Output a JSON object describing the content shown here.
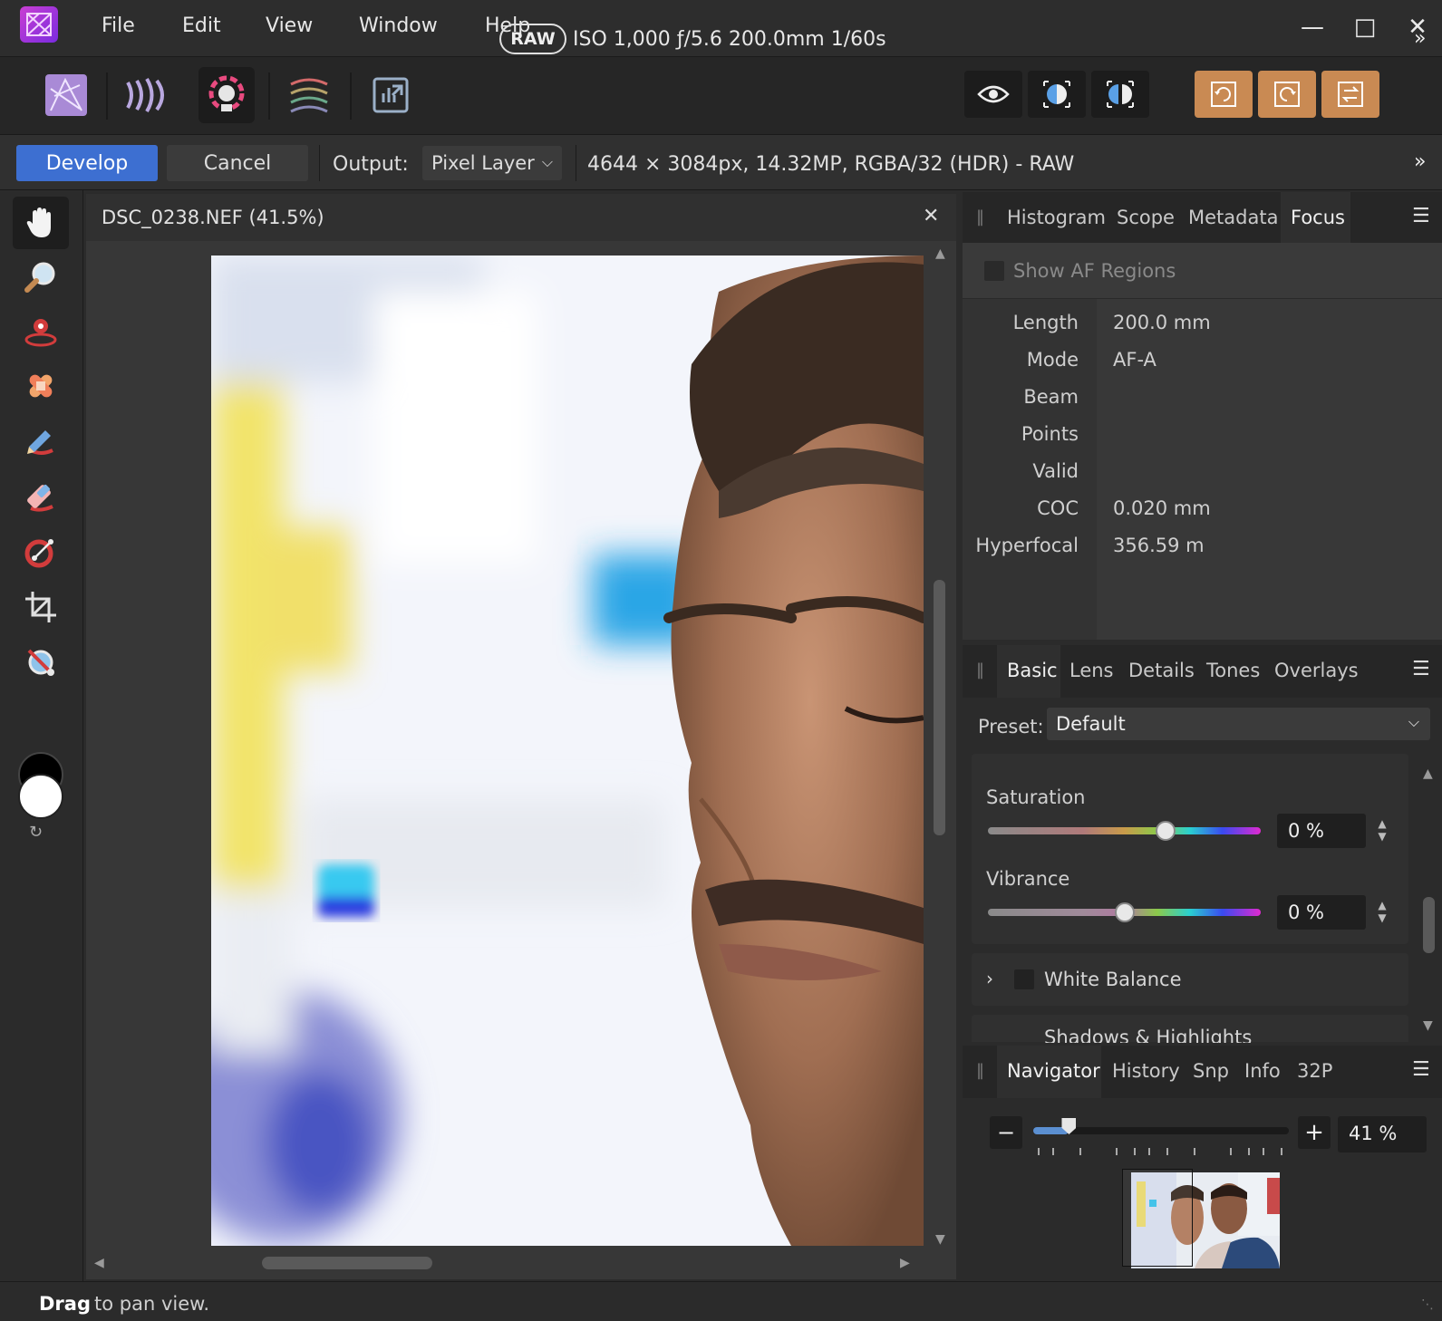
{
  "menubar": {
    "items": [
      "File",
      "Edit",
      "View",
      "Window",
      "Help"
    ],
    "window_controls": {
      "minimize": "—",
      "maximize": "□",
      "close": "✕"
    }
  },
  "toolbar": {
    "raw_badge": "RAW",
    "exif": "ISO 1,000 ƒ/5.6 200.0mm 1/60s",
    "personas": [
      "photo-persona-icon",
      "liquify-persona-icon",
      "develop-persona-icon",
      "tone-mapping-persona-icon",
      "export-persona-icon"
    ],
    "view_buttons": [
      "eye-icon",
      "split-view-icon",
      "mirror-view-icon"
    ],
    "orange_buttons": [
      "rotate-left-icon",
      "rotate-right-icon",
      "swap-icon"
    ],
    "more": "»"
  },
  "context": {
    "develop": "Develop",
    "cancel": "Cancel",
    "output_label": "Output:",
    "output_value": "Pixel Layer",
    "doc_info": "4644 × 3084px, 14.32MP, RGBA/32 (HDR) - RAW",
    "more": "»"
  },
  "tools": [
    "hand-icon",
    "zoom-icon",
    "red-eye-icon",
    "blemish-icon",
    "overlay-paint-icon",
    "overlay-erase-icon",
    "overlay-gradient-icon",
    "crop-icon",
    "white-balance-picker-icon"
  ],
  "document": {
    "title": "DSC_0238.NEF (41.5%)",
    "close": "✕"
  },
  "top_panel": {
    "tabs": [
      "Histogram",
      "Scope",
      "Metadata",
      "Focus"
    ],
    "active": "Focus",
    "show_af": "Show AF Regions",
    "rows": [
      {
        "label": "Length",
        "value": "200.0 mm"
      },
      {
        "label": "Mode",
        "value": "AF-A"
      },
      {
        "label": "Beam",
        "value": ""
      },
      {
        "label": "Points",
        "value": ""
      },
      {
        "label": "Valid",
        "value": ""
      },
      {
        "label": "COC",
        "value": "0.020 mm"
      },
      {
        "label": "Hyperfocal",
        "value": "356.59 m"
      }
    ]
  },
  "mid_panel": {
    "tabs": [
      "Basic",
      "Lens",
      "Details",
      "Tones",
      "Overlays"
    ],
    "active": "Basic",
    "preset_label": "Preset:",
    "preset_value": "Default",
    "saturation": {
      "label": "Saturation",
      "value": "0 %",
      "position": 0.65
    },
    "vibrance": {
      "label": "Vibrance",
      "value": "0 %",
      "position": 0.5
    },
    "white_balance": "White Balance",
    "shadows_highlights": "Shadows & Highlights"
  },
  "bottom_panel": {
    "tabs": [
      "Navigator",
      "History",
      "Snp",
      "Info",
      "32P"
    ],
    "active": "Navigator",
    "zoom_value": "41 %",
    "zoom_position": 0.14
  },
  "status": {
    "strong": "Drag",
    "rest": "to pan view."
  }
}
